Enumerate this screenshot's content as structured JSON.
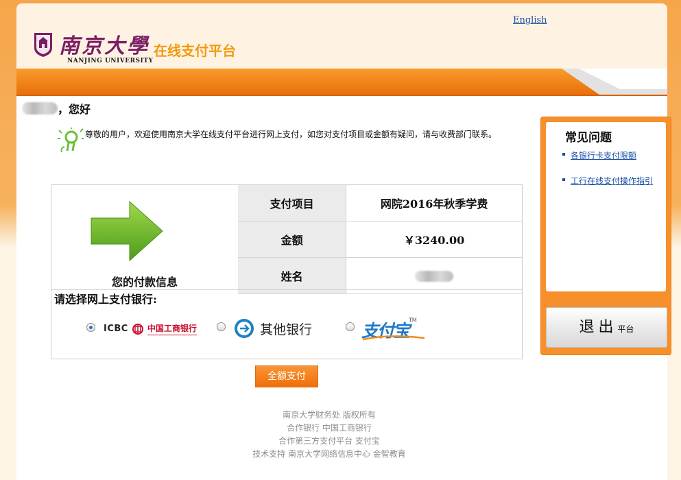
{
  "header": {
    "lang_link": "English",
    "logo_cn": "南京大學",
    "logo_en": "NANJING UNIVERSITY",
    "platform_title": "在线支付平台"
  },
  "greeting": {
    "suffix": "，您好"
  },
  "welcome_text": "尊敬的用户，欢迎使用南京大学在线支付平台进行网上支付，如您对支付项目或金额有疑问，请与收费部门联系。",
  "payment": {
    "caption": "您的付款信息",
    "rows": [
      {
        "label": "支付项目",
        "value": "网院2016年秋季学费"
      },
      {
        "label": "金额",
        "value": "￥3240.00"
      },
      {
        "label": "姓名",
        "value": ""
      }
    ],
    "bank_label": "请选择网上支付银行:",
    "banks": {
      "icbc_en": "ICBC",
      "icbc_cn": "中国工商银行",
      "other": "其他银行",
      "alipay": "支付宝",
      "alipay_tm": "TM"
    },
    "submit_label": "全额支付"
  },
  "faq": {
    "title": "常见问题",
    "items": [
      "各银行卡支付限额",
      "工行在线支付操作指引"
    ],
    "exit_main": "退出",
    "exit_sub": "平台"
  },
  "footer": {
    "lines": [
      "南京大学财务处  版权所有",
      "合作银行  中国工商银行",
      "合作第三方支付平台  支付宝",
      "技术支持  南京大学网络信息中心  金智教育"
    ]
  },
  "colors": {
    "accent_orange": "#f7902a",
    "title_orange": "#f29a12",
    "link_blue": "#1a4fa3",
    "logo_purple": "#7a1e63"
  }
}
